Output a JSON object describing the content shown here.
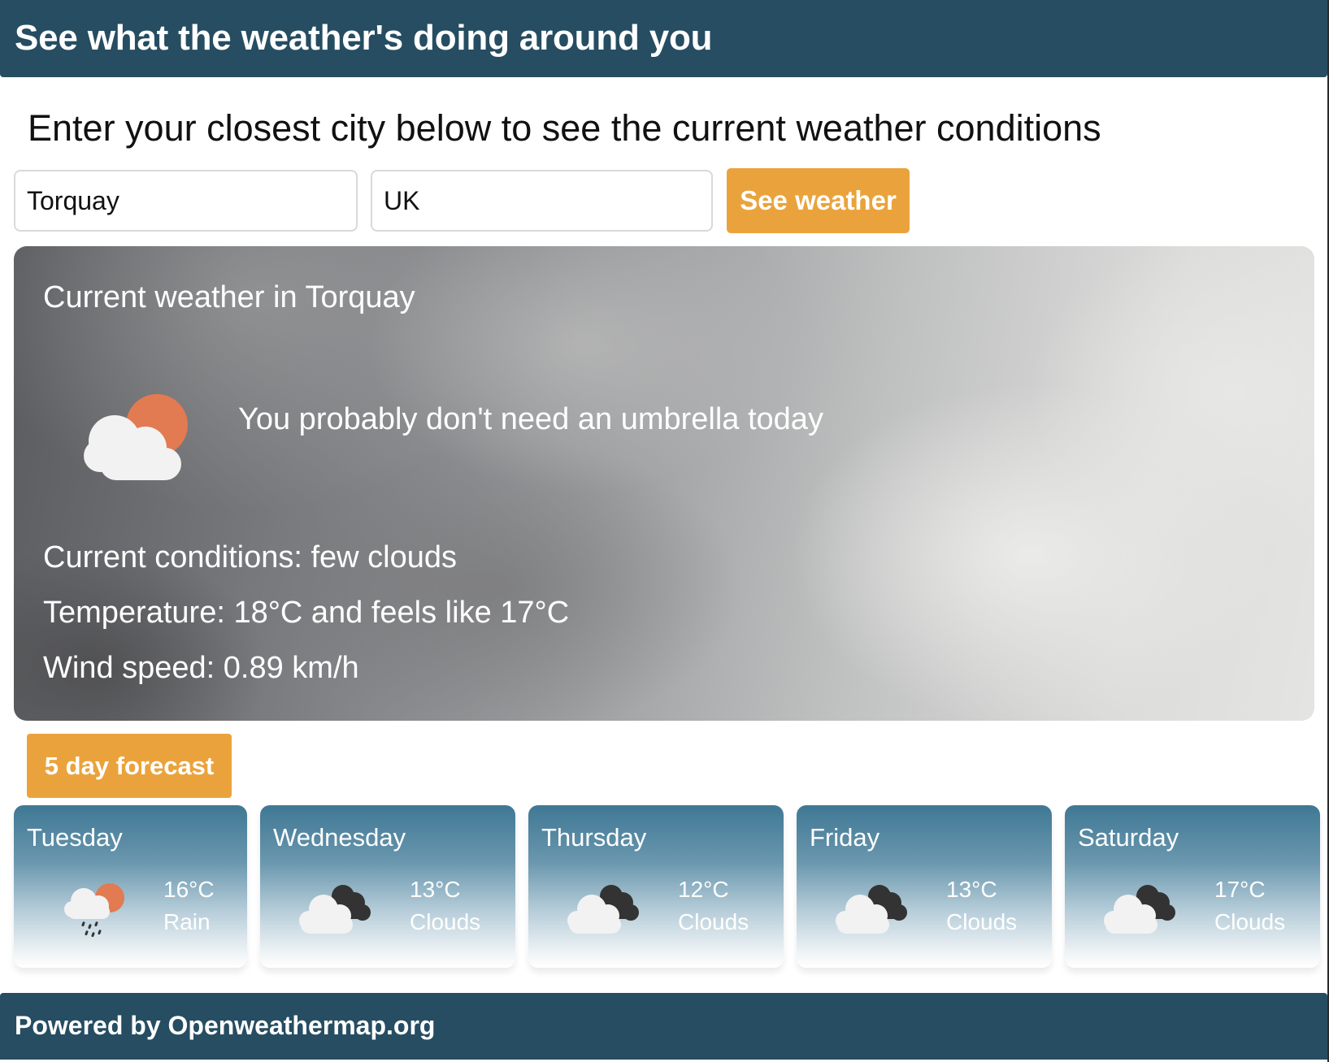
{
  "header": {
    "title": "See what the weather's doing around you"
  },
  "instructions": "Enter your closest city below to see the current weather conditions",
  "search": {
    "city_value": "Torquay",
    "country_value": "UK",
    "button_label": "See weather"
  },
  "current": {
    "title": "Current weather in Torquay",
    "icon": "few-clouds-day-icon",
    "message": "You probably don't need an umbrella today",
    "conditions": "Current conditions: few clouds",
    "temperature": "Temperature: 18°C and feels like 17°C",
    "wind": "Wind speed: 0.89 km/h"
  },
  "forecast": {
    "button_label": "5 day forecast",
    "days": [
      {
        "day": "Tuesday",
        "temp": "16°C",
        "desc": "Rain",
        "icon": "rain-icon"
      },
      {
        "day": "Wednesday",
        "temp": "13°C",
        "desc": "Clouds",
        "icon": "broken-clouds-icon"
      },
      {
        "day": "Thursday",
        "temp": "12°C",
        "desc": "Clouds",
        "icon": "broken-clouds-icon"
      },
      {
        "day": "Friday",
        "temp": "13°C",
        "desc": "Clouds",
        "icon": "broken-clouds-icon"
      },
      {
        "day": "Saturday",
        "temp": "17°C",
        "desc": "Clouds",
        "icon": "broken-clouds-icon"
      }
    ]
  },
  "footer": {
    "text": "Powered by Openweathermap.org"
  },
  "colors": {
    "header_bg": "#264d61",
    "accent_orange": "#eaa33c",
    "sun_orange": "#e27a52",
    "cloud_white": "#f2f2f2",
    "cloud_dark": "#333333"
  }
}
